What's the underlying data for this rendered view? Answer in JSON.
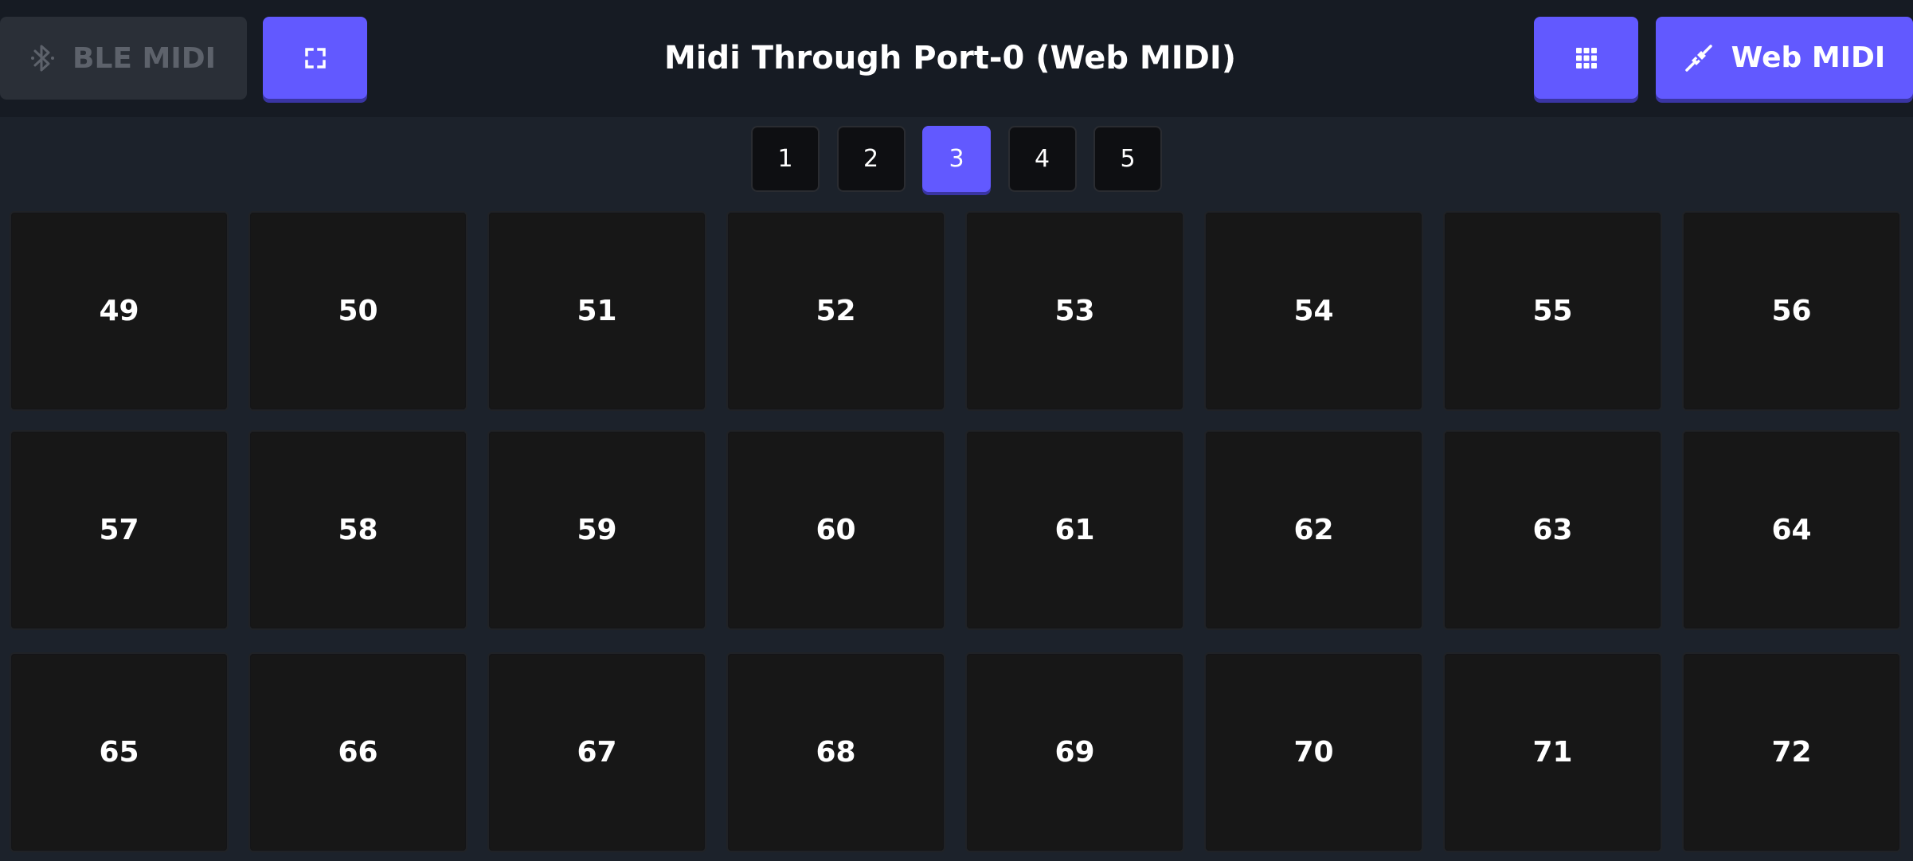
{
  "header": {
    "ble_button": {
      "label": "BLE MIDI",
      "icon": "bluetooth-icon",
      "state": "disabled"
    },
    "fullscreen_button": {
      "icon": "fullscreen-icon"
    },
    "title": "Midi Through Port-0 (Web MIDI)",
    "grid_button": {
      "icon": "grid-icon"
    },
    "webmidi_button": {
      "label": "Web MIDI",
      "icon": "cable-icon"
    }
  },
  "pages": {
    "items": [
      "1",
      "2",
      "3",
      "4",
      "5"
    ],
    "active": "3"
  },
  "pads": [
    "49",
    "50",
    "51",
    "52",
    "53",
    "54",
    "55",
    "56",
    "57",
    "58",
    "59",
    "60",
    "61",
    "62",
    "63",
    "64",
    "65",
    "66",
    "67",
    "68",
    "69",
    "70",
    "71",
    "72"
  ],
  "colors": {
    "background": "#1c222b",
    "header": "#161b23",
    "accent": "#6259ff",
    "pad": "#171717",
    "disabled_button": "#2a2f37",
    "disabled_text": "#5d626b"
  }
}
